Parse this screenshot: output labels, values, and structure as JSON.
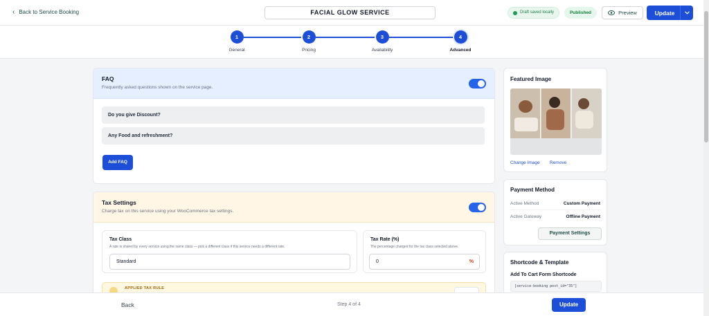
{
  "header": {
    "back_label": "Back to Service Booking",
    "service_title": "FACIAL GLOW SERVICE",
    "draft_badge": "Draft saved locally",
    "published_badge": "Published",
    "preview_label": "Preview",
    "update_label": "Update"
  },
  "steps": [
    {
      "number": "1",
      "label": "General"
    },
    {
      "number": "2",
      "label": "Pricing"
    },
    {
      "number": "3",
      "label": "Availability"
    },
    {
      "number": "4",
      "label": "Advanced"
    }
  ],
  "faq": {
    "title": "FAQ",
    "subtitle": "Frequently asked questions shown on the service page.",
    "items": [
      "Do you give Discount?",
      "Any Food and refreshment?"
    ],
    "add_label": "Add FAQ"
  },
  "tax": {
    "title": "Tax Settings",
    "subtitle": "Charge tax on this service using your WooCommerce tax settings.",
    "class_label": "Tax Class",
    "class_help": "A rate is shared by every service using the same class — pick a different class if this service needs a different rate.",
    "class_value": "Standard",
    "rate_label": "Tax Rate (%)",
    "rate_help": "The percentage charged for the tax class selected above.",
    "rate_value": "0",
    "rate_unit": "%",
    "applied_rule_label": "APPLIED TAX RULE"
  },
  "featured_image": {
    "title": "Featured Image",
    "change_label": "Change Image",
    "remove_label": "Remove"
  },
  "payment": {
    "title": "Payment Method",
    "active_method_label": "Active Method",
    "active_method_value": "Custom Payment",
    "active_gateway_label": "Active Gateway",
    "active_gateway_value": "Offline Payment",
    "settings_label": "Payment Settings"
  },
  "shortcode": {
    "title": "Shortcode & Template",
    "subtitle": "Add To Cart Form Shortcode",
    "code": "[service-booking post_id=\"35\"]"
  },
  "footer": {
    "back_label": "Back",
    "step_text": "Step 4 of 4",
    "update_label": "Update"
  },
  "colors": {
    "accent": "#1d4ed8",
    "faq_header_bg": "#e6efff",
    "tax_header_bg": "#fff6e6"
  }
}
